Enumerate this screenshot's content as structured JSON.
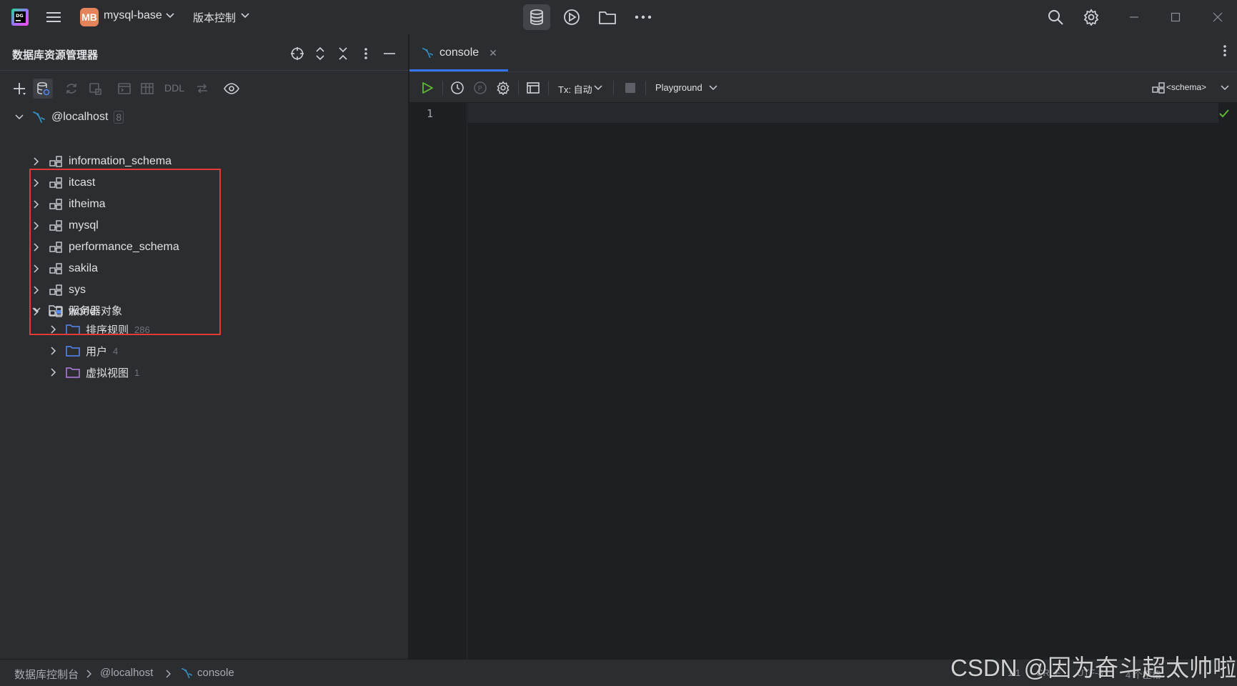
{
  "titlebar": {
    "project_badge": "MB",
    "project_name": "mysql-base",
    "vcs_label": "版本控制"
  },
  "db_explorer": {
    "title": "数据库资源管理器",
    "toolbar": {
      "ddl_label": "DDL"
    },
    "root": {
      "name": "@localhost",
      "count": "8"
    },
    "schemas": [
      "information_schema",
      "itcast",
      "itheima",
      "mysql",
      "performance_schema",
      "sakila",
      "sys",
      "world"
    ],
    "server_objects": {
      "label": "服务器对象",
      "children": [
        {
          "label": "排序规则",
          "count": "286"
        },
        {
          "label": "用户",
          "count": "4"
        },
        {
          "label": "虚拟视图",
          "count": "1"
        }
      ]
    }
  },
  "editor": {
    "tab_name": "console",
    "tx_label": "Tx: 自动",
    "playground_label": "Playground",
    "schema_label": "<schema>",
    "line_number": "1"
  },
  "statusbar": {
    "crumbs": [
      "数据库控制台",
      "@localhost",
      "console"
    ],
    "position": "1:1",
    "line_sep": "CRLF",
    "encoding": "UTF-8",
    "indent": "4 个空格"
  },
  "watermark": "CSDN @因为奋斗超太帅啦",
  "colors": {
    "accent": "#3574f0",
    "highlight_box": "#e53935",
    "run_green": "#5fb832",
    "folder_purple": "#b57ee5"
  }
}
